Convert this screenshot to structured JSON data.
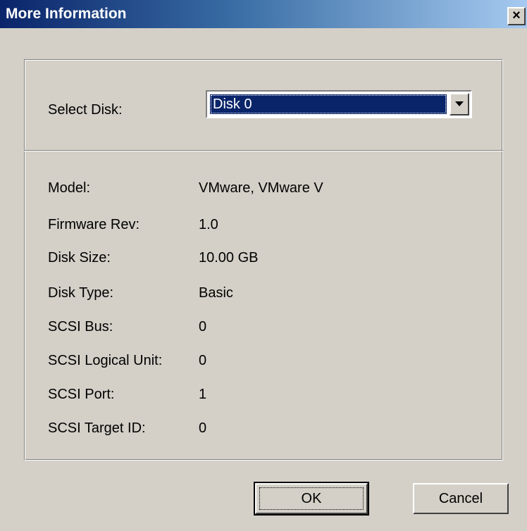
{
  "window": {
    "title": "More Information",
    "close_glyph": "×"
  },
  "disk_selector": {
    "label": "Select Disk:",
    "selected": "Disk 0",
    "options": [
      "Disk 0"
    ]
  },
  "properties": [
    {
      "label": "Model:",
      "value": "VMware, VMware V"
    },
    {
      "label": "Firmware Rev:",
      "value": "1.0"
    },
    {
      "label": "Disk Size:",
      "value": "10.00 GB"
    },
    {
      "label": "Disk Type:",
      "value": "Basic"
    },
    {
      "label": "SCSI Bus:",
      "value": "0"
    },
    {
      "label": "SCSI Logical Unit:",
      "value": "0"
    },
    {
      "label": "SCSI Port:",
      "value": "1"
    },
    {
      "label": "SCSI Target ID:",
      "value": "0"
    }
  ],
  "buttons": {
    "ok": "OK",
    "cancel": "Cancel"
  },
  "colors": {
    "titlebar_start": "#0a246a",
    "titlebar_end": "#a6caf0",
    "face": "#d4d0c8",
    "selection": "#0a246a"
  }
}
